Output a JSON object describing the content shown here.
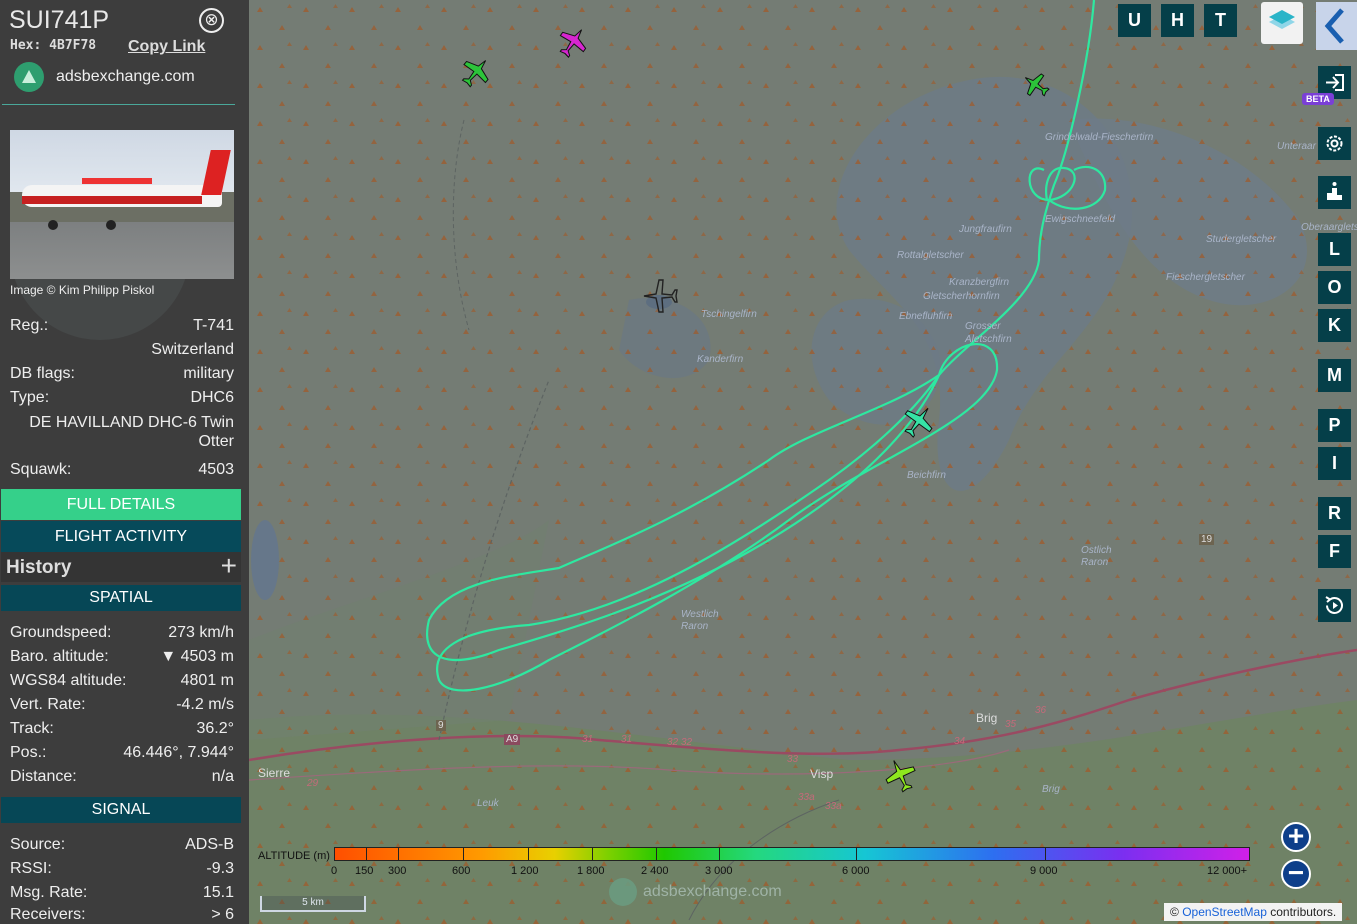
{
  "aircraft": {
    "callsign": "SUI741P",
    "hex_label": "Hex:",
    "hex": "4B7F78",
    "copy_link": "Copy Link",
    "close_icon": "⊗",
    "site_link": "adsbexchange.com",
    "photo_credit": "Image © Kim Philipp Piskol"
  },
  "details": [
    {
      "key": "Reg.:",
      "value": "T-741"
    },
    {
      "key": "",
      "value": "Switzerland"
    },
    {
      "key": "DB flags:",
      "value": "military"
    },
    {
      "key": "Type:",
      "value": "DHC6"
    },
    {
      "key": "",
      "value": "DE HAVILLAND DHC-6 Twin Otter"
    },
    {
      "key": "Squawk:",
      "value": "4503"
    }
  ],
  "buttons": {
    "full_details": "FULL DETAILS",
    "flight_activity": "FLIGHT ACTIVITY",
    "history": "History",
    "history_plus": "+"
  },
  "spatial": {
    "header": "SPATIAL",
    "rows": [
      {
        "key": "Groundspeed:",
        "value": "273 km/h"
      },
      {
        "key": "Baro. altitude:",
        "value": "▼ 4503 m"
      },
      {
        "key": "WGS84 altitude:",
        "value": "4801 m"
      },
      {
        "key": "Vert. Rate:",
        "value": "-4.2 m/s"
      },
      {
        "key": "Track:",
        "value": "36.2°"
      },
      {
        "key": "Pos.:",
        "value": "46.446°, 7.944°"
      },
      {
        "key": "Distance:",
        "value": "n/a"
      }
    ]
  },
  "signal": {
    "header": "SIGNAL",
    "rows": [
      {
        "key": "Source:",
        "value": "ADS-B"
      },
      {
        "key": "RSSI:",
        "value": "-9.3"
      },
      {
        "key": "Msg. Rate:",
        "value": "15.1"
      },
      {
        "key": "Receivers:",
        "value": "> 6"
      }
    ]
  },
  "map": {
    "top_buttons": [
      "U",
      "H",
      "T"
    ],
    "right_buttons": [
      "L",
      "O",
      "K",
      "M",
      "P",
      "I",
      "R",
      "F"
    ],
    "beta": "BETA",
    "zoom_in": "+",
    "zoom_out": "−",
    "scale": "5 km",
    "watermark": "adsbexchange.com",
    "attribution_prefix": "© ",
    "attribution_link": "OpenStreetMap",
    "attribution_suffix": " contributors.",
    "place_labels": [
      "Grindelwald-Fieschertirn",
      "Ewigschneefeld",
      "Jungfraufirn",
      "Unteraar",
      "Oberaargletsch",
      "Studergletscher",
      "Fieschergletscher",
      "Rottalgletscher",
      "Kranzbergfirn",
      "Gletscherhornfirn",
      "Ebnefluhfirn",
      "Grosser Aletschfirn",
      "Tschingelfirn",
      "Kanderfirn",
      "Beichfirn",
      "Ostlich Raron",
      "Westlich Raron",
      "Brig",
      "Visp",
      "Sierre",
      "Leuk",
      "Brig",
      "A9"
    ],
    "road_numbers": [
      "9",
      "19",
      "29",
      "31",
      "31",
      "32",
      "32",
      "33",
      "33a",
      "33a",
      "34",
      "35",
      "36"
    ],
    "colors": {
      "track": "#2ee8a0",
      "aircraft_selected": "#36e2a6",
      "aircraft_green": "#2cc43a",
      "aircraft_magenta": "#d626d0",
      "aircraft_yellow": "#8ee81e"
    }
  },
  "altitude_legend": {
    "label": "ALTITUDE (m)",
    "ticks": [
      "0",
      "150",
      "300",
      "600",
      "1 200",
      "1 800",
      "2 400",
      "3 000",
      "6 000",
      "9 000",
      "12 000+"
    ]
  }
}
